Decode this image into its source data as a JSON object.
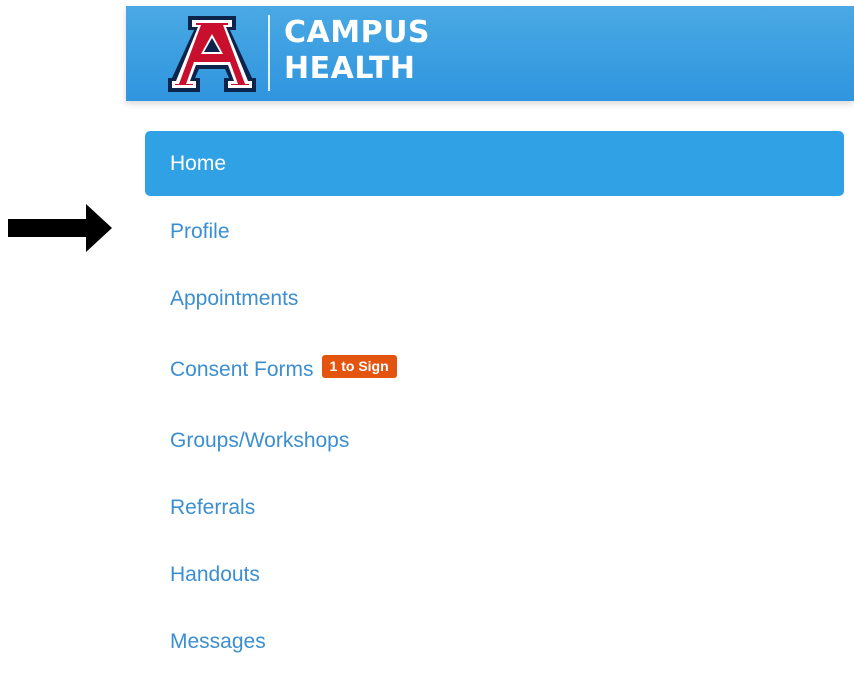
{
  "header": {
    "brand_line1": "CAMPUS",
    "brand_line2": "HEALTH",
    "logo_icon": "university-a-logo",
    "colors": {
      "header_bg": "#3a9fe2",
      "logo_red": "#c8102e",
      "logo_navy": "#0c234b"
    }
  },
  "nav": {
    "items": [
      {
        "label": "Home",
        "active": true
      },
      {
        "label": "Profile"
      },
      {
        "label": "Appointments"
      },
      {
        "label": "Consent Forms",
        "badge": "1 to Sign"
      },
      {
        "label": "Groups/Workshops"
      },
      {
        "label": "Referrals"
      },
      {
        "label": "Handouts"
      },
      {
        "label": "Messages"
      }
    ],
    "colors": {
      "active_bg": "#31a1e6",
      "link": "#3b8fd1",
      "badge_bg": "#e3540f"
    }
  },
  "annotation": {
    "icon": "pointer-arrow-icon"
  }
}
